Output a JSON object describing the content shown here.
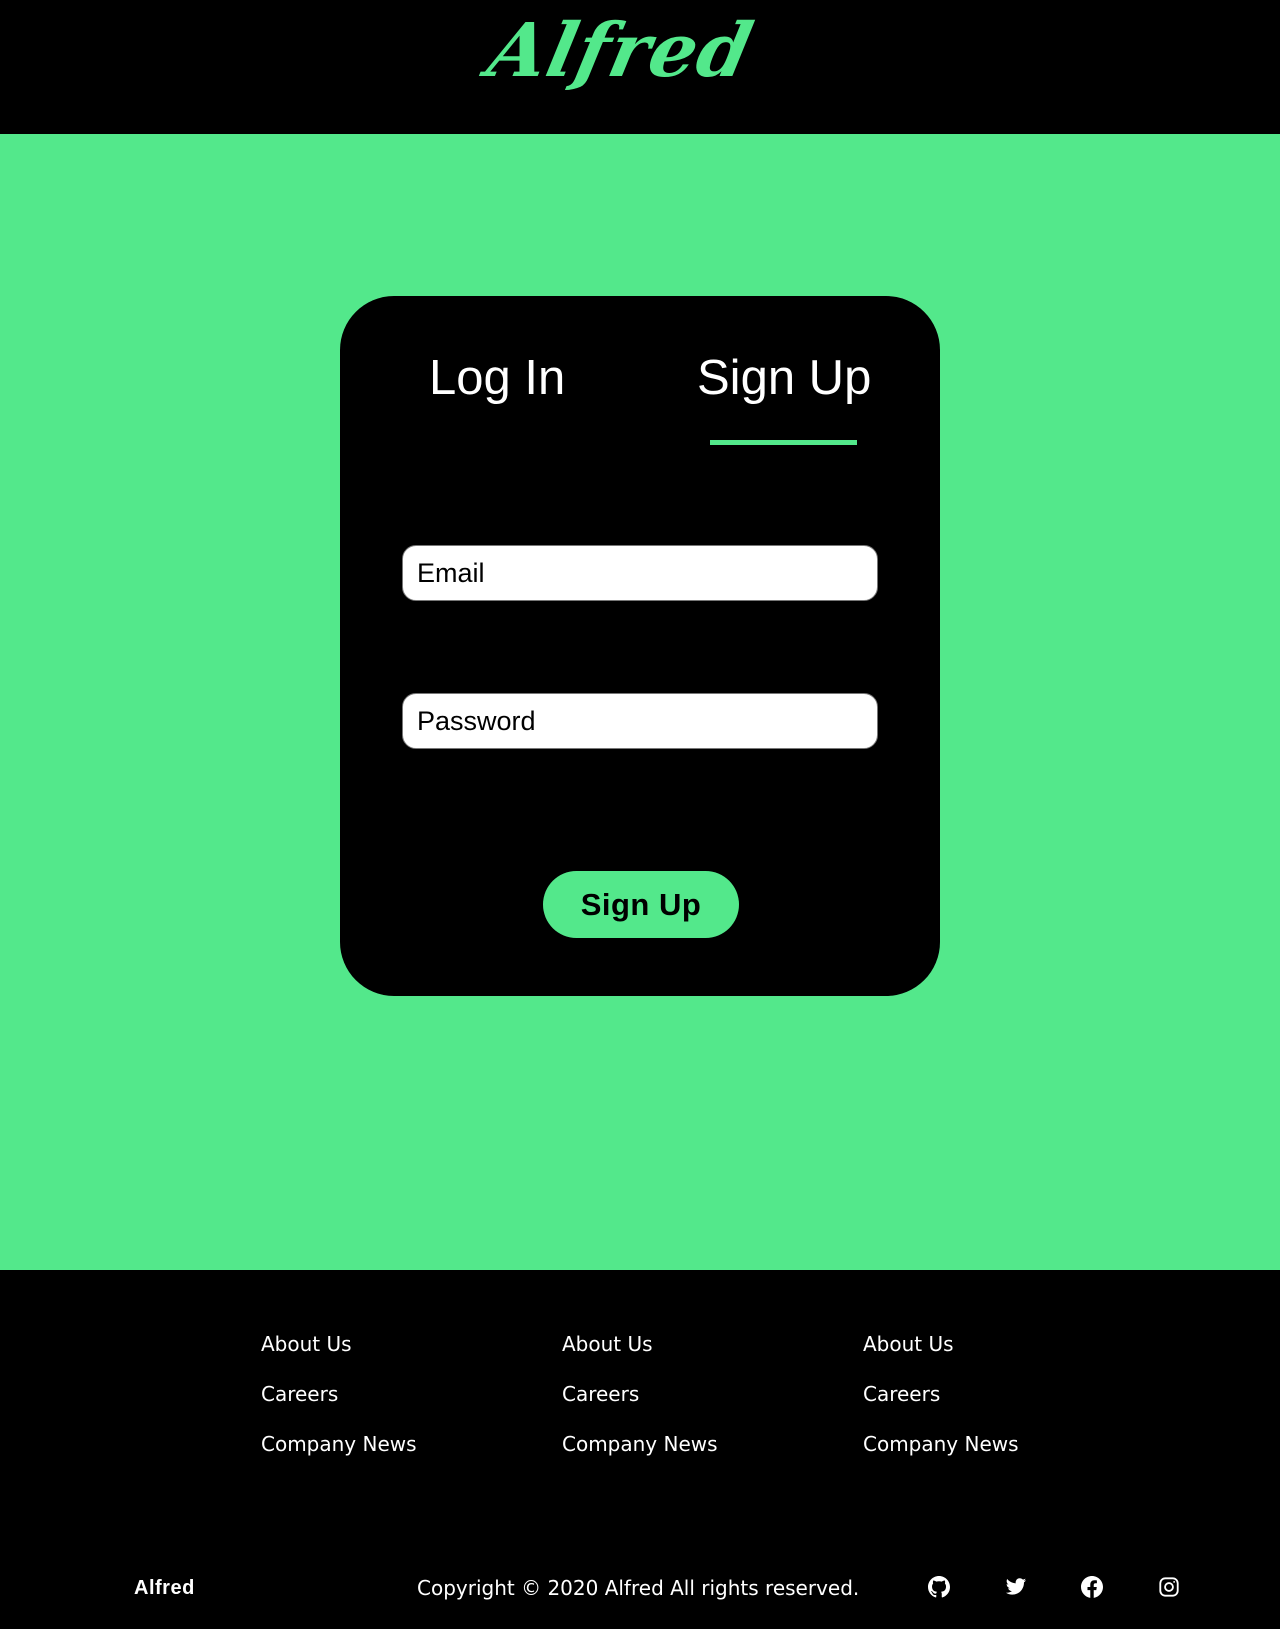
{
  "header": {
    "logo_text": "Alfred"
  },
  "auth_card": {
    "tabs": [
      {
        "label": "Log In",
        "active": false
      },
      {
        "label": "Sign Up",
        "active": true
      }
    ],
    "email": {
      "placeholder": "Email",
      "value": ""
    },
    "password": {
      "placeholder": "Password",
      "value": ""
    },
    "submit_label": "Sign Up"
  },
  "footer": {
    "columns": [
      {
        "links": [
          "About Us",
          "Careers",
          "Company News"
        ]
      },
      {
        "links": [
          "About Us",
          "Careers",
          "Company News"
        ]
      },
      {
        "links": [
          "About Us",
          "Careers",
          "Company News"
        ]
      }
    ],
    "brand": "Alfred",
    "copyright": "Copyright © 2020 Alfred All rights reserved.",
    "social_icons": [
      "github-icon",
      "twitter-icon",
      "facebook-icon",
      "instagram-icon"
    ]
  },
  "colors": {
    "accent": "#53e88b",
    "dark": "#000000",
    "field_bg": "#ffffff"
  }
}
